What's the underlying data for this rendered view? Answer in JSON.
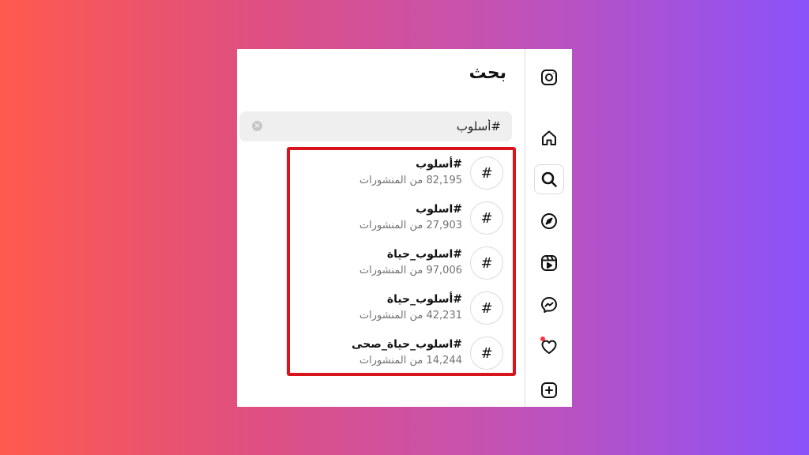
{
  "search": {
    "title": "بحث",
    "query": "#أسلوب",
    "clear_symbol": "×"
  },
  "results": [
    {
      "hashtag_symbol": "#",
      "tag": "#أسلوب",
      "posts": "82,195 من المنشورات"
    },
    {
      "hashtag_symbol": "#",
      "tag": "#اسلوب",
      "posts": "27,903 من المنشورات"
    },
    {
      "hashtag_symbol": "#",
      "tag": "#اسلوب_حياة",
      "posts": "97,006 من المنشورات"
    },
    {
      "hashtag_symbol": "#",
      "tag": "#أسلوب_حياة",
      "posts": "42,231 من المنشورات"
    },
    {
      "hashtag_symbol": "#",
      "tag": "#اسلوب_حياة_صحى",
      "posts": "14,244 من المنشورات"
    }
  ],
  "nav": {
    "icons": [
      "instagram-logo-icon",
      "home-icon",
      "search-icon",
      "explore-compass-icon",
      "reels-icon",
      "messenger-icon",
      "heart-icon",
      "create-plus-icon"
    ],
    "active": "search-icon",
    "notification_color": "#ff3040"
  },
  "colors": {
    "highlight_border": "#D9141D",
    "gradient_start": "#FF5A4E",
    "gradient_end": "#8B52FB"
  }
}
